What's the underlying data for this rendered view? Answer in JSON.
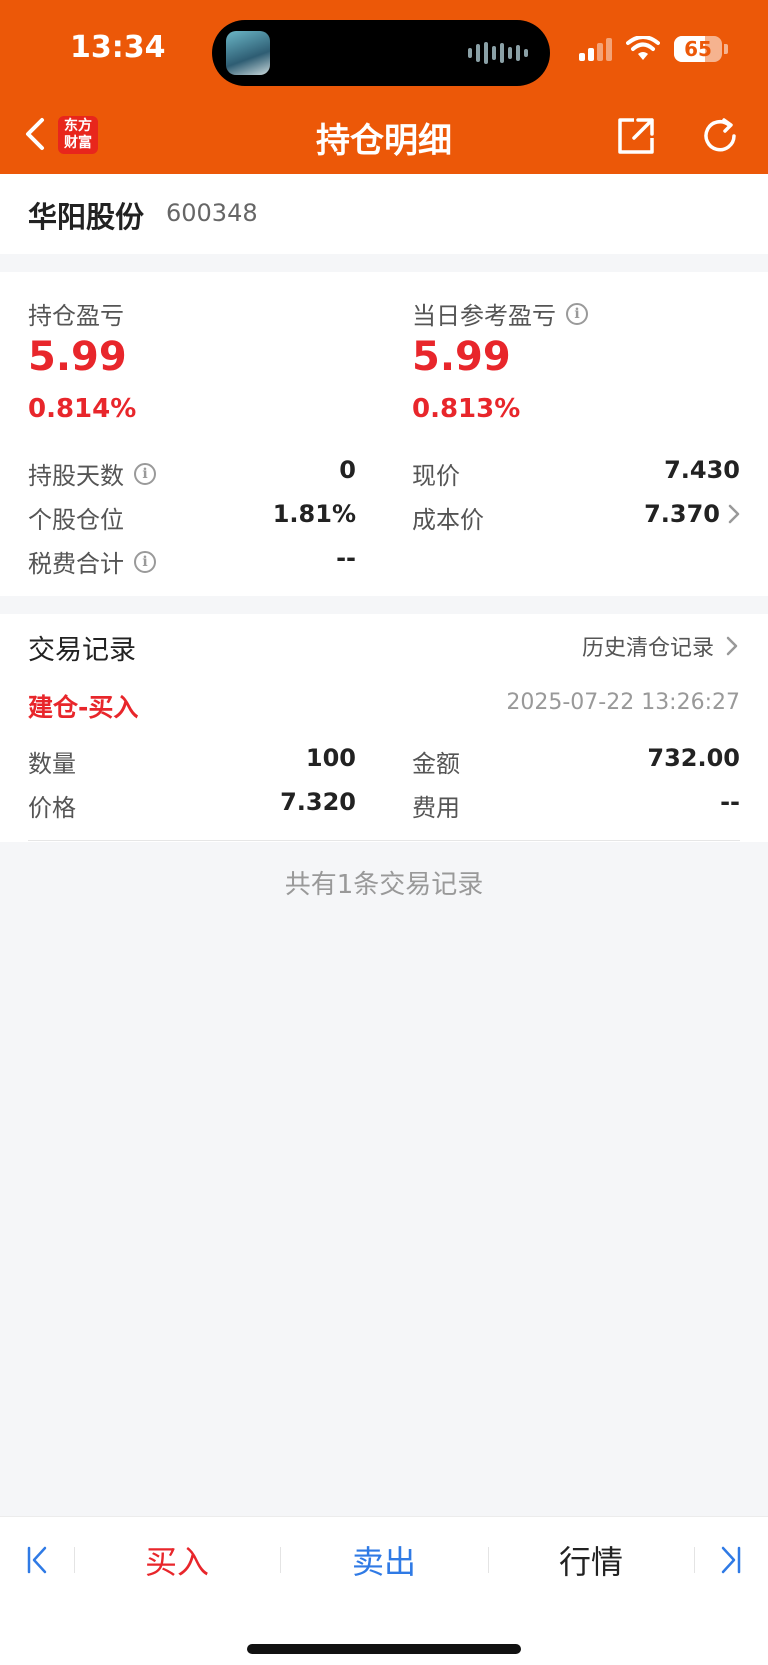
{
  "status_bar": {
    "time": "13:34",
    "battery": "65",
    "battery_level": 0.65
  },
  "nav": {
    "title": "持仓明细",
    "logo_line1": "东方",
    "logo_line2": "财富"
  },
  "stock": {
    "name": "华阳股份",
    "code": "600348"
  },
  "pnl": {
    "holding": {
      "label": "持仓盈亏",
      "value": "5.99",
      "pct": "0.814%"
    },
    "daily": {
      "label": "当日参考盈亏",
      "value": "5.99",
      "pct": "0.813%"
    },
    "left_rows": [
      {
        "key": "持股天数",
        "value": "0"
      },
      {
        "key": "个股仓位",
        "value": "1.81%"
      },
      {
        "key": "税费合计",
        "value": "--"
      }
    ],
    "right_rows": [
      {
        "key": "现价",
        "value": "7.430"
      },
      {
        "key": "成本价",
        "value": "7.370"
      }
    ]
  },
  "trades": {
    "title": "交易记录",
    "history_link": "历史清仓记录",
    "records": [
      {
        "type": "建仓-买入",
        "time": "2025-07-22 13:26:27",
        "fields": [
          {
            "key": "数量",
            "value": "100"
          },
          {
            "key": "金额",
            "value": "732.00"
          },
          {
            "key": "价格",
            "value": "7.320"
          },
          {
            "key": "费用",
            "value": "--"
          }
        ]
      }
    ],
    "count_text": "共有1条交易记录"
  },
  "bottom_bar": {
    "buy": "买入",
    "sell": "卖出",
    "quote": "行情"
  },
  "colors": {
    "header": "#ec5808",
    "up_red": "#e8262b",
    "link_blue": "#2f7ae5"
  }
}
